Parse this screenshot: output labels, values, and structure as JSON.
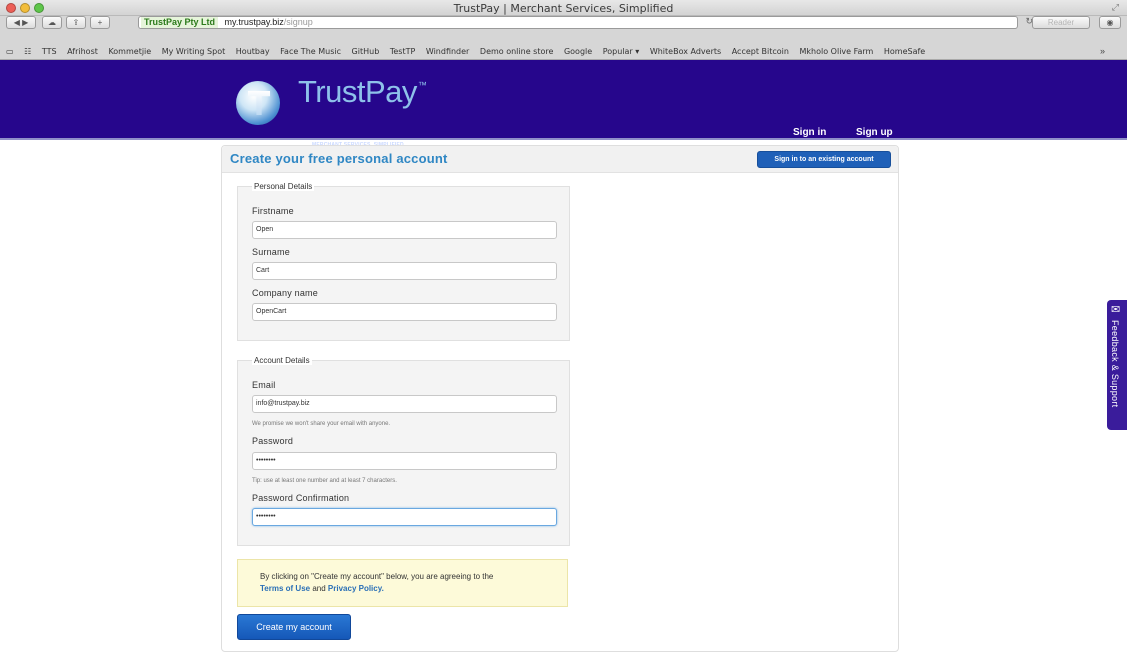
{
  "window": {
    "title": "TrustPay | Merchant Services, Simplified"
  },
  "browser": {
    "site_badge": "TrustPay Pty Ltd",
    "url_host": "my.trustpay.biz",
    "url_path": "/signup",
    "reader_label": "Reader",
    "bookmarks": [
      "TTS",
      "Afrihost",
      "Kommetjie",
      "My Writing Spot",
      "Houtbay",
      "Face The Music",
      "GitHub",
      "TestTP",
      "Windfinder",
      "Demo online store",
      "Google",
      "Popular ▾",
      "WhiteBox Adverts",
      "Accept Bitcoin",
      "Mkholo Olive Farm",
      "HomeSafe"
    ]
  },
  "header": {
    "logo_text": "TrustPay",
    "logo_tm": "™",
    "tagline": "MERCHANT SERVICES. SIMPLIFIED",
    "sign_in": "Sign in",
    "sign_up": "Sign up",
    "brand_color": "#26068c"
  },
  "form": {
    "title": "Create your free personal account",
    "signin_button": "Sign in to an existing account",
    "personal": {
      "legend": "Personal Details",
      "firstname_label": "Firstname",
      "firstname_value": "Open",
      "surname_label": "Surname",
      "surname_value": "Cart",
      "company_label": "Company name",
      "company_value": "OpenCart"
    },
    "account": {
      "legend": "Account Details",
      "email_label": "Email",
      "email_value": "info@trustpay.biz",
      "email_help": "We promise we won't share your email with anyone.",
      "password_label": "Password",
      "password_value": "••••••••",
      "password_help": "Tip: use at least one number and at least 7 characters.",
      "confirm_label": "Password Confirmation",
      "confirm_value": "••••••••"
    },
    "notice": {
      "line1": "By clicking on \"Create my account\" below, you are agreeing to the",
      "terms": "Terms of Use",
      "and": "and",
      "privacy": "Privacy Policy."
    },
    "create_button": "Create my account"
  },
  "feedback": {
    "label": "Feedback & Support"
  }
}
